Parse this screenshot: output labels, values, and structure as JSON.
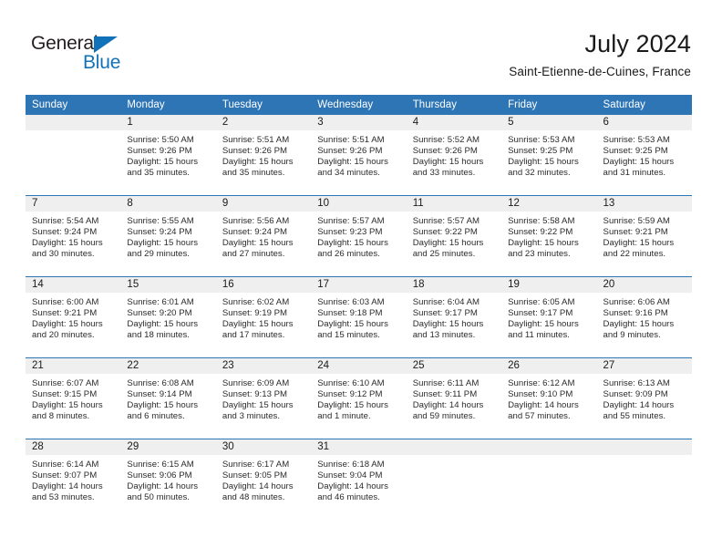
{
  "brand": {
    "name_part1": "General",
    "name_part2": "Blue",
    "triangle_icon": "blue-triangle-logo-mark",
    "accent_color": "#1272b9",
    "text_color": "#231f20"
  },
  "header": {
    "month_title": "July 2024",
    "location": "Saint-Etienne-de-Cuines, France",
    "header_band_color": "#2e75b6",
    "daynum_band_color": "#efefef"
  },
  "weekday_headers": [
    "Sunday",
    "Monday",
    "Tuesday",
    "Wednesday",
    "Thursday",
    "Friday",
    "Saturday"
  ],
  "labels": {
    "sunrise_prefix": "Sunrise:",
    "sunset_prefix": "Sunset:",
    "daylight_prefix": "Daylight:"
  },
  "weeks": [
    [
      {
        "day": "",
        "blank": true,
        "empty_shaded": true,
        "lines": []
      },
      {
        "day": "1",
        "lines": [
          "Sunrise: 5:50 AM",
          "Sunset: 9:26 PM",
          "Daylight: 15 hours",
          "and 35 minutes."
        ]
      },
      {
        "day": "2",
        "lines": [
          "Sunrise: 5:51 AM",
          "Sunset: 9:26 PM",
          "Daylight: 15 hours",
          "and 35 minutes."
        ]
      },
      {
        "day": "3",
        "lines": [
          "Sunrise: 5:51 AM",
          "Sunset: 9:26 PM",
          "Daylight: 15 hours",
          "and 34 minutes."
        ]
      },
      {
        "day": "4",
        "lines": [
          "Sunrise: 5:52 AM",
          "Sunset: 9:26 PM",
          "Daylight: 15 hours",
          "and 33 minutes."
        ]
      },
      {
        "day": "5",
        "lines": [
          "Sunrise: 5:53 AM",
          "Sunset: 9:25 PM",
          "Daylight: 15 hours",
          "and 32 minutes."
        ]
      },
      {
        "day": "6",
        "lines": [
          "Sunrise: 5:53 AM",
          "Sunset: 9:25 PM",
          "Daylight: 15 hours",
          "and 31 minutes."
        ]
      }
    ],
    [
      {
        "day": "7",
        "lines": [
          "Sunrise: 5:54 AM",
          "Sunset: 9:24 PM",
          "Daylight: 15 hours",
          "and 30 minutes."
        ]
      },
      {
        "day": "8",
        "lines": [
          "Sunrise: 5:55 AM",
          "Sunset: 9:24 PM",
          "Daylight: 15 hours",
          "and 29 minutes."
        ]
      },
      {
        "day": "9",
        "lines": [
          "Sunrise: 5:56 AM",
          "Sunset: 9:24 PM",
          "Daylight: 15 hours",
          "and 27 minutes."
        ]
      },
      {
        "day": "10",
        "lines": [
          "Sunrise: 5:57 AM",
          "Sunset: 9:23 PM",
          "Daylight: 15 hours",
          "and 26 minutes."
        ]
      },
      {
        "day": "11",
        "lines": [
          "Sunrise: 5:57 AM",
          "Sunset: 9:22 PM",
          "Daylight: 15 hours",
          "and 25 minutes."
        ]
      },
      {
        "day": "12",
        "lines": [
          "Sunrise: 5:58 AM",
          "Sunset: 9:22 PM",
          "Daylight: 15 hours",
          "and 23 minutes."
        ]
      },
      {
        "day": "13",
        "lines": [
          "Sunrise: 5:59 AM",
          "Sunset: 9:21 PM",
          "Daylight: 15 hours",
          "and 22 minutes."
        ]
      }
    ],
    [
      {
        "day": "14",
        "lines": [
          "Sunrise: 6:00 AM",
          "Sunset: 9:21 PM",
          "Daylight: 15 hours",
          "and 20 minutes."
        ]
      },
      {
        "day": "15",
        "lines": [
          "Sunrise: 6:01 AM",
          "Sunset: 9:20 PM",
          "Daylight: 15 hours",
          "and 18 minutes."
        ]
      },
      {
        "day": "16",
        "lines": [
          "Sunrise: 6:02 AM",
          "Sunset: 9:19 PM",
          "Daylight: 15 hours",
          "and 17 minutes."
        ]
      },
      {
        "day": "17",
        "lines": [
          "Sunrise: 6:03 AM",
          "Sunset: 9:18 PM",
          "Daylight: 15 hours",
          "and 15 minutes."
        ]
      },
      {
        "day": "18",
        "lines": [
          "Sunrise: 6:04 AM",
          "Sunset: 9:17 PM",
          "Daylight: 15 hours",
          "and 13 minutes."
        ]
      },
      {
        "day": "19",
        "lines": [
          "Sunrise: 6:05 AM",
          "Sunset: 9:17 PM",
          "Daylight: 15 hours",
          "and 11 minutes."
        ]
      },
      {
        "day": "20",
        "lines": [
          "Sunrise: 6:06 AM",
          "Sunset: 9:16 PM",
          "Daylight: 15 hours",
          "and 9 minutes."
        ]
      }
    ],
    [
      {
        "day": "21",
        "lines": [
          "Sunrise: 6:07 AM",
          "Sunset: 9:15 PM",
          "Daylight: 15 hours",
          "and 8 minutes."
        ]
      },
      {
        "day": "22",
        "lines": [
          "Sunrise: 6:08 AM",
          "Sunset: 9:14 PM",
          "Daylight: 15 hours",
          "and 6 minutes."
        ]
      },
      {
        "day": "23",
        "lines": [
          "Sunrise: 6:09 AM",
          "Sunset: 9:13 PM",
          "Daylight: 15 hours",
          "and 3 minutes."
        ]
      },
      {
        "day": "24",
        "lines": [
          "Sunrise: 6:10 AM",
          "Sunset: 9:12 PM",
          "Daylight: 15 hours",
          "and 1 minute."
        ]
      },
      {
        "day": "25",
        "lines": [
          "Sunrise: 6:11 AM",
          "Sunset: 9:11 PM",
          "Daylight: 14 hours",
          "and 59 minutes."
        ]
      },
      {
        "day": "26",
        "lines": [
          "Sunrise: 6:12 AM",
          "Sunset: 9:10 PM",
          "Daylight: 14 hours",
          "and 57 minutes."
        ]
      },
      {
        "day": "27",
        "lines": [
          "Sunrise: 6:13 AM",
          "Sunset: 9:09 PM",
          "Daylight: 14 hours",
          "and 55 minutes."
        ]
      }
    ],
    [
      {
        "day": "28",
        "lines": [
          "Sunrise: 6:14 AM",
          "Sunset: 9:07 PM",
          "Daylight: 14 hours",
          "and 53 minutes."
        ]
      },
      {
        "day": "29",
        "lines": [
          "Sunrise: 6:15 AM",
          "Sunset: 9:06 PM",
          "Daylight: 14 hours",
          "and 50 minutes."
        ]
      },
      {
        "day": "30",
        "lines": [
          "Sunrise: 6:17 AM",
          "Sunset: 9:05 PM",
          "Daylight: 14 hours",
          "and 48 minutes."
        ]
      },
      {
        "day": "31",
        "lines": [
          "Sunrise: 6:18 AM",
          "Sunset: 9:04 PM",
          "Daylight: 14 hours",
          "and 46 minutes."
        ]
      },
      {
        "day": "",
        "blank": true,
        "empty_shaded": true,
        "lines": []
      },
      {
        "day": "",
        "blank": true,
        "empty_shaded": true,
        "lines": []
      },
      {
        "day": "",
        "blank": true,
        "empty_shaded": true,
        "lines": []
      }
    ]
  ]
}
